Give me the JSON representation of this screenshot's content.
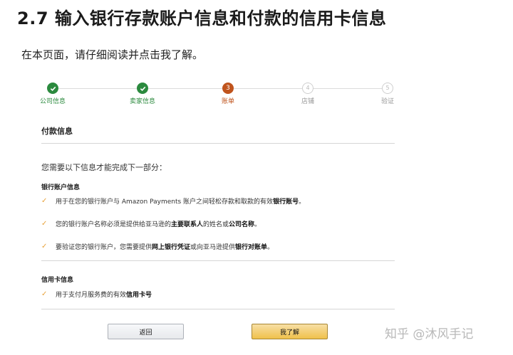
{
  "heading": "2.7 输入银行存款账户信息和付款的信用卡信息",
  "intro": "在本页面，请仔细阅读并点击我了解。",
  "steps": [
    {
      "label": "公司信息",
      "number": "",
      "state": "done"
    },
    {
      "label": "卖家信息",
      "number": "",
      "state": "done"
    },
    {
      "label": "账单",
      "number": "3",
      "state": "current"
    },
    {
      "label": "店铺",
      "number": "4",
      "state": "pending"
    },
    {
      "label": "验证",
      "number": "5",
      "state": "pending"
    }
  ],
  "payment": {
    "title": "付款信息",
    "need_text": "您需要以下信息才能完成下一部分：",
    "bank_title": "银行账户信息",
    "bank_items": [
      {
        "pre": "用于在您的银行账户与 Amazon Payments 账户之间轻松存款和取款的有效",
        "bold": "银行账号",
        "post": "。"
      },
      {
        "pre": "您的银行账户名称必须是提供给亚马逊的",
        "bold": "主要联系人",
        "mid": "的姓名或",
        "bold2": "公司名称",
        "post": "。"
      },
      {
        "pre": "要验证您的银行账户，您需要提供",
        "bold": "网上银行凭证",
        "mid": "或向亚马逊提供",
        "bold2": "银行对账单",
        "post": "。"
      }
    ],
    "card_title": "信用卡信息",
    "card_items": [
      {
        "pre": "用于支付月服务费的有效",
        "bold": "信用卡号",
        "post": ""
      }
    ]
  },
  "buttons": {
    "back": "返回",
    "next": "我了解"
  },
  "watermark": "知乎 @沐风手记",
  "colors": {
    "done": "#2b8a3e",
    "current": "#c0541d",
    "check": "#e8a23a",
    "primary_button": "#f0c14b"
  }
}
